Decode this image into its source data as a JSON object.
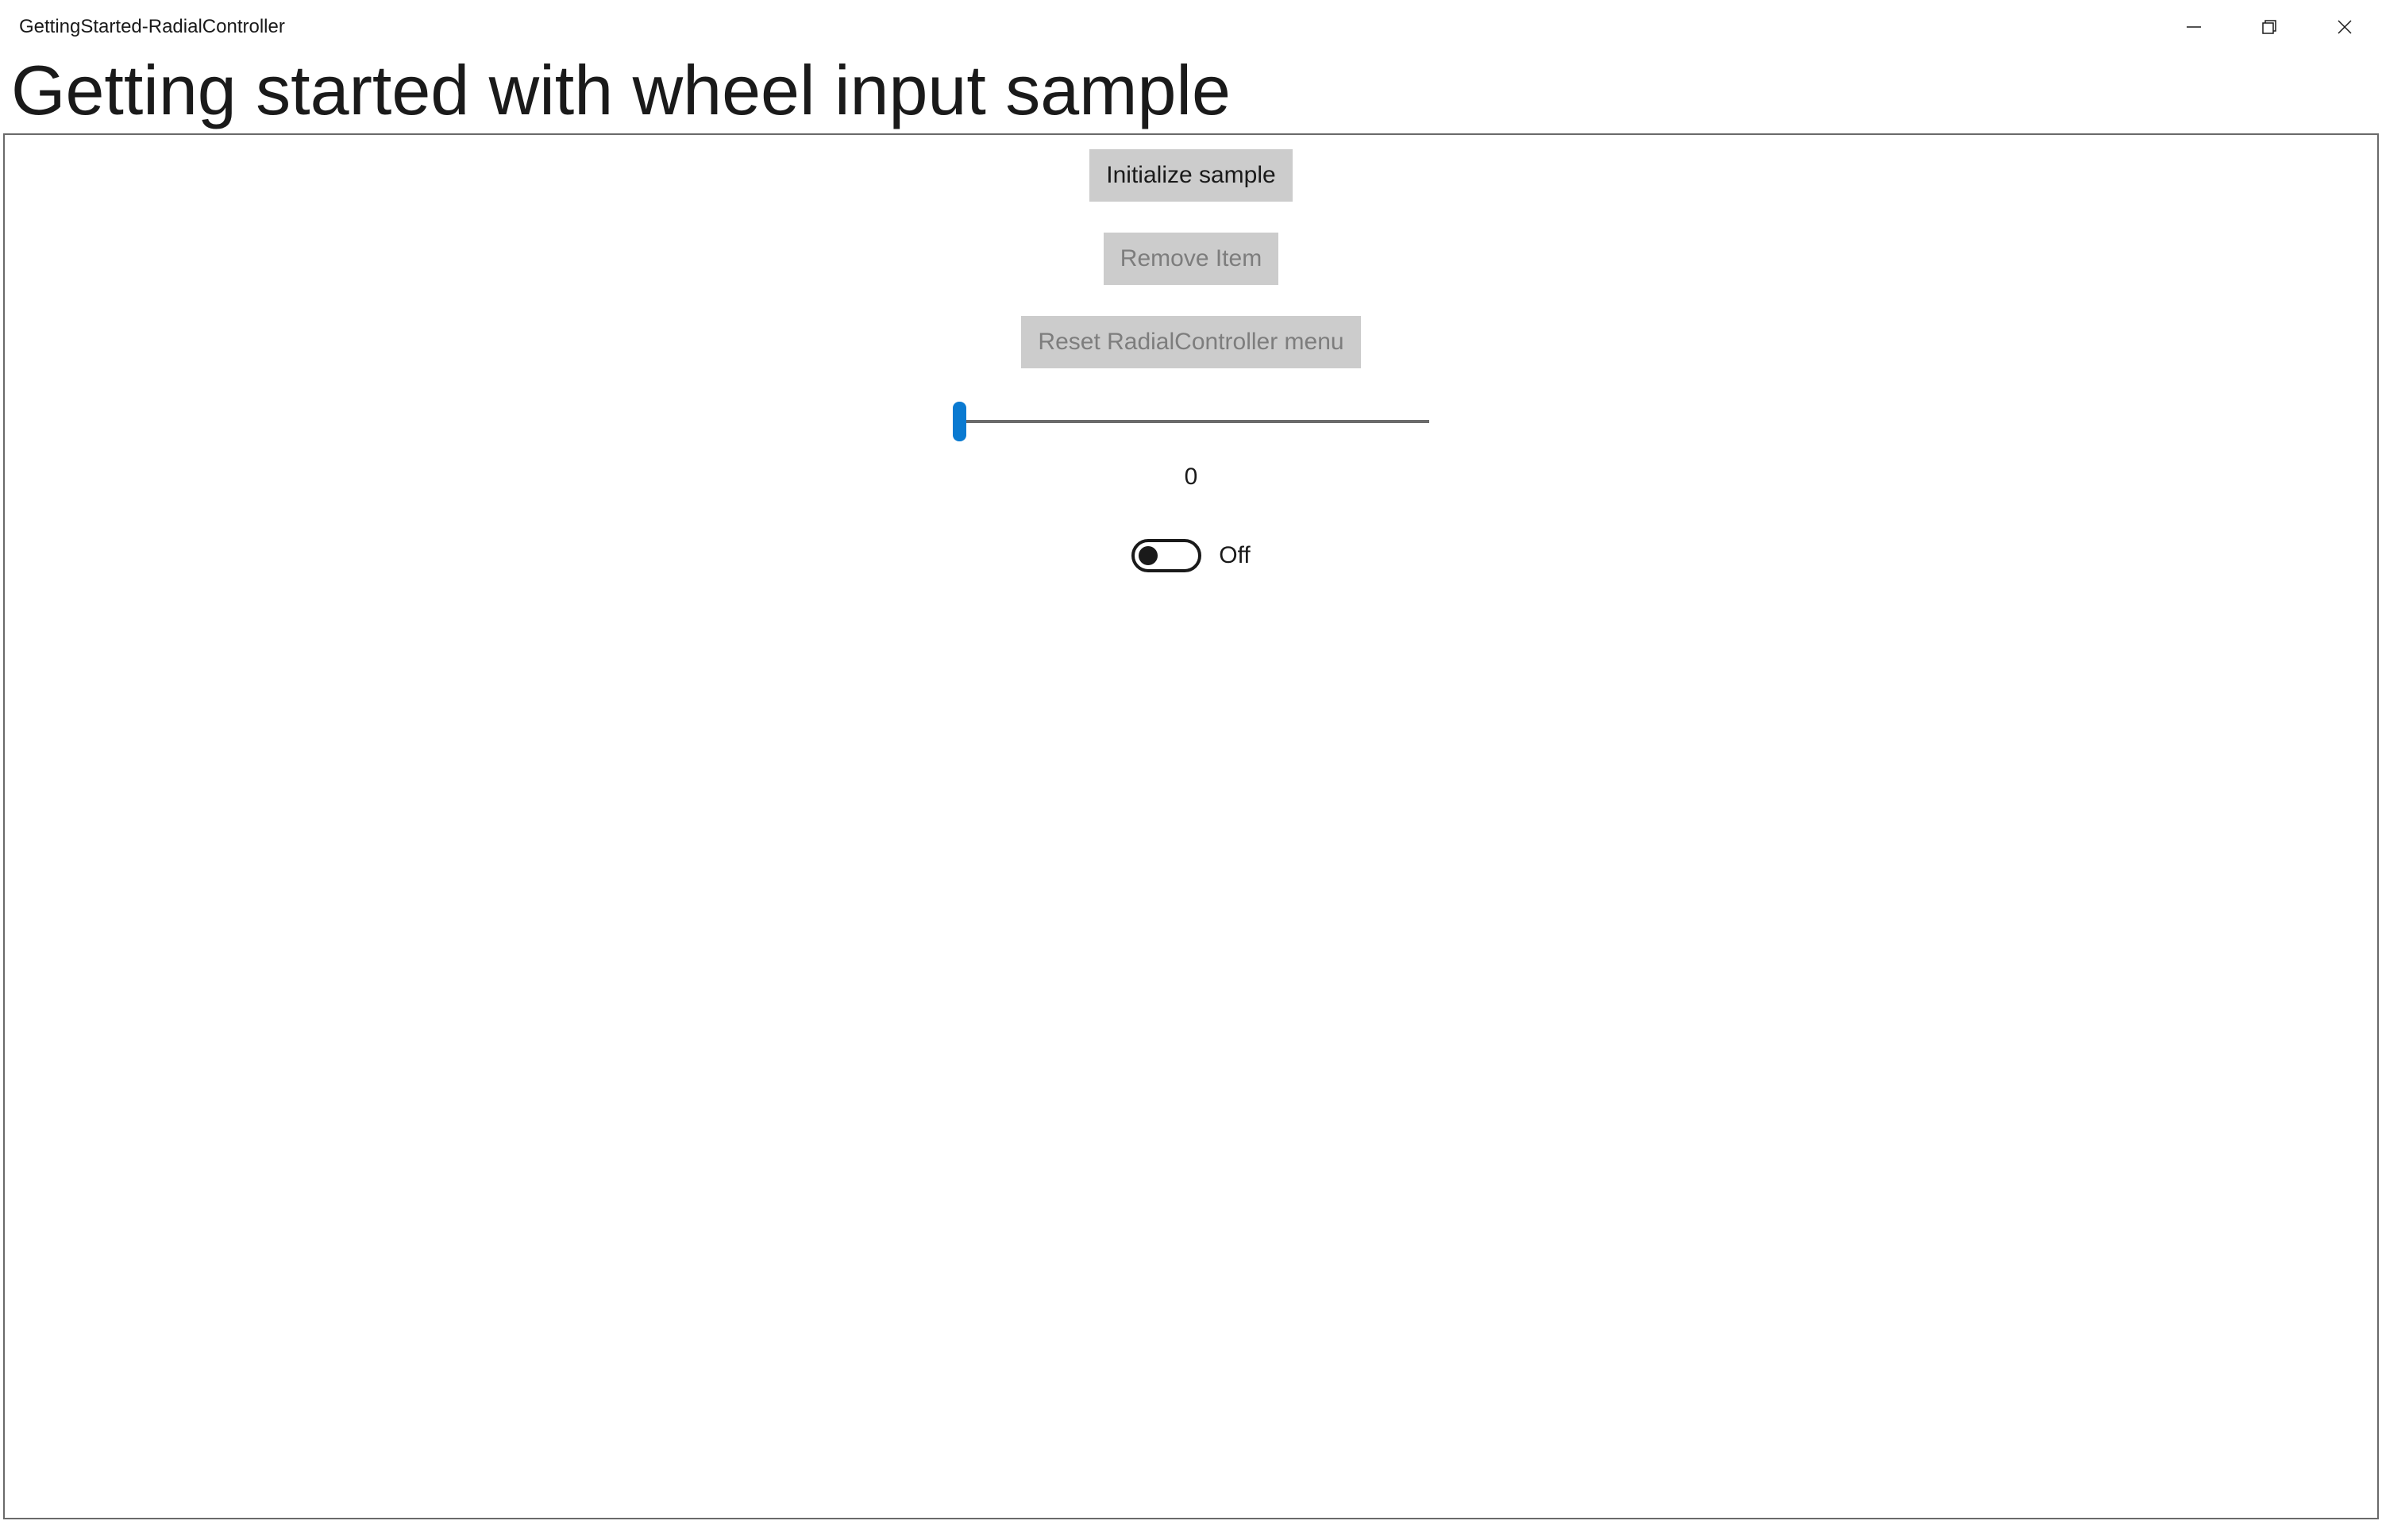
{
  "window": {
    "app_title": "GettingStarted-RadialController"
  },
  "page": {
    "title": "Getting started with wheel input sample"
  },
  "buttons": {
    "initialize": {
      "label": "Initialize sample",
      "enabled": true
    },
    "remove": {
      "label": "Remove Item",
      "enabled": false
    },
    "reset": {
      "label": "Reset RadialController menu",
      "enabled": false
    }
  },
  "slider": {
    "value": 0,
    "value_text": "0",
    "min": 0,
    "max": 10
  },
  "toggle": {
    "state": "off",
    "label": "Off"
  }
}
